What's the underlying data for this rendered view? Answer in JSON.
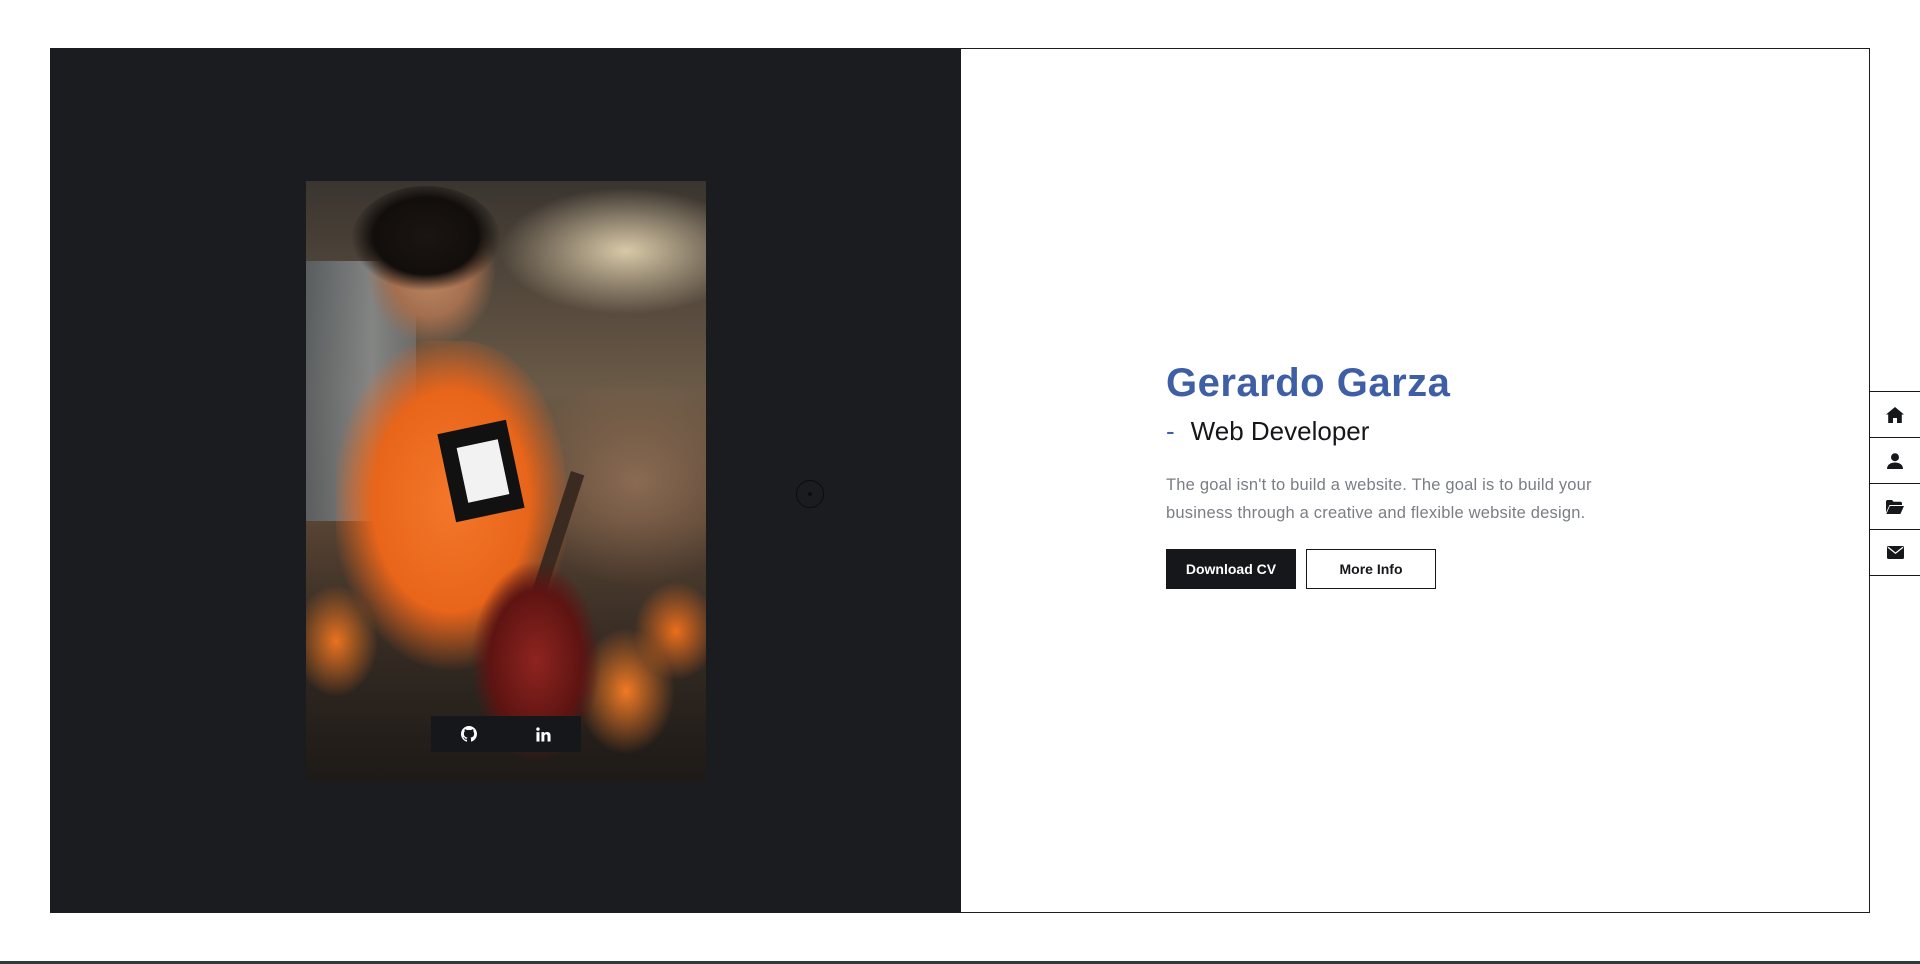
{
  "profile": {
    "name": "Gerardo Garza",
    "role_dash": "-",
    "role": "Web Developer",
    "description_line1": "The goal isn't to build a website. The goal is to build your",
    "description_line2": "business through a creative and flexible website design."
  },
  "buttons": {
    "download_label": "Download CV",
    "more_info_label": "More Info"
  },
  "social": [
    {
      "icon": "github-icon"
    },
    {
      "icon": "linkedin-icon"
    }
  ],
  "side_nav": [
    {
      "icon": "home-icon"
    },
    {
      "icon": "user-icon"
    },
    {
      "icon": "folder-icon"
    },
    {
      "icon": "envelope-icon"
    }
  ],
  "colors": {
    "accent": "#3e5ea5",
    "dark_panel": "#1b1c20",
    "text_dark": "#16171a",
    "text_muted": "#7a7d85"
  }
}
